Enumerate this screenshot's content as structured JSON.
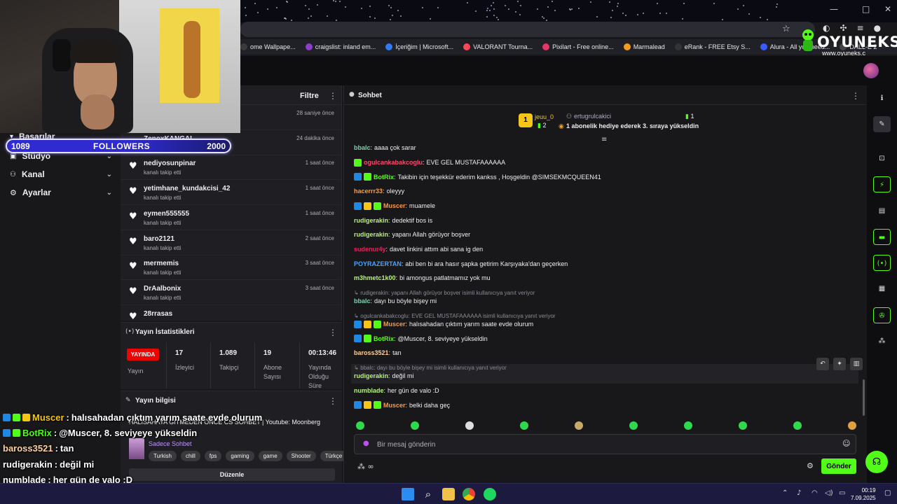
{
  "browser": {
    "bookmarks": [
      {
        "label": "ome Wallpape...",
        "color": "#3a3a3a"
      },
      {
        "label": "craigslist: inland em...",
        "color": "#8b3fc9"
      },
      {
        "label": "İçeriğim | Microsoft...",
        "color": "#2d7cf6"
      },
      {
        "label": "VALORANT Tourna...",
        "color": "#ff4655"
      },
      {
        "label": "Pixilart - Free online...",
        "color": "#e63465"
      },
      {
        "label": "Marmalead",
        "color": "#f29c1f"
      },
      {
        "label": "eRank - FREE Etsy S...",
        "color": "#333333"
      },
      {
        "label": "Alura - All you need...",
        "color": "#3b5bfd"
      },
      {
        "label": "DALL-E 2",
        "color": "#444444"
      }
    ]
  },
  "logo": {
    "name": "OYUNEKS",
    "url": "www.oyuneks.c"
  },
  "webcam": {
    "followers_current": "1089",
    "followers_label": "FOLLOWERS",
    "followers_goal": "2000",
    "progress": 0.5445
  },
  "leftnav": {
    "partial_item": "Başarılar",
    "items": [
      {
        "label": "Stüdyo",
        "icon": "video-icon"
      },
      {
        "label": "Kanal",
        "icon": "users-icon"
      },
      {
        "label": "Ayarlar",
        "icon": "gear-icon"
      }
    ]
  },
  "activity": {
    "filter_label": "Filtre",
    "items": [
      {
        "name": "",
        "sub": "",
        "time": "28 saniye önce"
      },
      {
        "name": "ZenoxKANGAL",
        "sub": "kanalı takip etti",
        "time": "24 dakika önce"
      },
      {
        "name": "nediyosunpinar",
        "sub": "kanalı takip etti",
        "time": "1 saat önce"
      },
      {
        "name": "yetimhane_kundakcisi_42",
        "sub": "kanalı takip etti",
        "time": "1 saat önce"
      },
      {
        "name": "eymen555555",
        "sub": "kanalı takip etti",
        "time": "1 saat önce"
      },
      {
        "name": "baro2121",
        "sub": "kanalı takip etti",
        "time": "2 saat önce"
      },
      {
        "name": "mermemis",
        "sub": "kanalı takip etti",
        "time": "3 saat önce"
      },
      {
        "name": "DrAalbonix",
        "sub": "kanalı takip etti",
        "time": "3 saat önce"
      },
      {
        "name": "28rrasas",
        "sub": "",
        "time": ""
      }
    ]
  },
  "stats": {
    "title": "Yayın İstatistikleri",
    "live_badge": "YAYINDA",
    "live_label": "Yayın",
    "columns": [
      {
        "value": "17",
        "label": "İzleyici"
      },
      {
        "value": "1.089",
        "label": "Takipçi"
      },
      {
        "value": "19",
        "label": "Abone Sayısı"
      },
      {
        "value": "00:13:46",
        "label": "Yayında Olduğu Süre"
      }
    ]
  },
  "stream_info": {
    "title": "Yayın bilgisi",
    "description": "HALISAHAYA GİTMEDEN ÖNCE CS SOHBET | Youtube: Moonberg",
    "category": "Sadece Sohbet",
    "tags": [
      "Turkish",
      "chill",
      "fps",
      "gaming",
      "game",
      "Shooter",
      "Türkçe"
    ],
    "edit_label": "Düzenle"
  },
  "chat": {
    "title": "Sohbet",
    "leaderboard": {
      "rank": "1",
      "first_name": "jeuu_0",
      "first_count": "2",
      "second_name": "ertugrulcakici",
      "second_count": "1",
      "message": "1 abonelik hediye ederek 3. sıraya yükseldin"
    },
    "messages": [
      {
        "user": "bbalc",
        "color": "#7fd1ae",
        "text": "aaaa çok sarar",
        "badges": []
      },
      {
        "user": "ogulcankabakcoglu",
        "color": "#ff4a6e",
        "text": "EVE GEL MUSTAFAAAAAA",
        "badges": [
          "#53fc18"
        ]
      },
      {
        "user": "BotRix",
        "color": "#53fc18",
        "text": "Takibin için teşekkür ederim kankss , Hoşgeldin @SIMSEKMCQUEEN41",
        "badges": [
          "#1e88e5",
          "#53fc18"
        ]
      },
      {
        "user": "hacerrr33",
        "color": "#ff9a3c",
        "text": "oleyyy",
        "badges": []
      },
      {
        "user": "Muscer",
        "color": "#ff9a3c",
        "text": "muamele",
        "badges": [
          "#1e88e5",
          "#f5c518",
          "#53fc18"
        ]
      },
      {
        "user": "rudigerakin",
        "color": "#b9f27a",
        "text": "dedektif bos is",
        "badges": []
      },
      {
        "user": "rudigerakin",
        "color": "#b9f27a",
        "text": "yapanı Allah görüyor boşver",
        "badges": []
      },
      {
        "user": "sudenur4y",
        "color": "#e0245e",
        "text": "davet linkini attım abi sana ig den",
        "badges": []
      },
      {
        "user": "POYRAZERTAN",
        "color": "#4aa3ff",
        "text": "abi ben bi ara hasır şapka getirim Karşıyaka'dan geçerken",
        "badges": []
      },
      {
        "user": "m3hmetc1k00",
        "color": "#b9f27a",
        "text": "bi amongus patlatmamız yok mu",
        "badges": []
      },
      {
        "reply": "rudigerakin: yapanı Allah görüyor boşver isimli kullanıcıya yanıt veriyor",
        "user": "bbalc",
        "color": "#7fd1ae",
        "text": "dayı bu böyle bişey mi",
        "badges": []
      },
      {
        "reply": "ogulcankabakcoglu: EVE GEL MUSTAFAAAAAA isimli kullanıcıya yanıt veriyor",
        "user": "Muscer",
        "color": "#ff9a3c",
        "text": "halısahadan çıktım yarım saate evde olurum",
        "badges": [
          "#1e88e5",
          "#f5c518",
          "#53fc18"
        ]
      },
      {
        "user": "BotRix",
        "color": "#53fc18",
        "text": "@Muscer, 8. seviyeye yükseldin",
        "badges": [
          "#1e88e5",
          "#53fc18"
        ]
      },
      {
        "user": "baross3521",
        "color": "#ffd39a",
        "text": "tan",
        "badges": []
      },
      {
        "reply": "bbalc: dayı bu böyle bişey mi isimli kullanıcıya yanıt veriyor",
        "user": "rudigerakin",
        "color": "#b9f27a",
        "text": "değil mi",
        "badges": []
      },
      {
        "user": "numblade",
        "color": "#b9f27a",
        "text": "her gün de valo :D",
        "badges": []
      },
      {
        "user": "Muscer",
        "color": "#ff9a3c",
        "text": "belki daha geç",
        "badges": [
          "#1e88e5",
          "#f5c518",
          "#53fc18"
        ]
      }
    ],
    "input_placeholder": "Bir mesaj gönderin",
    "send_label": "Gönder"
  },
  "overlay_chat": [
    {
      "user": "Muscer",
      "color": "#f5c518",
      "text": "halısahadan çıktım yarım saate evde olurum",
      "badges": [
        "#1e88e5",
        "#53fc18",
        "#f5c518"
      ]
    },
    {
      "user": "BotRix",
      "color": "#53fc18",
      "text": "@Muscer, 8. seviyeye yükseldin",
      "badges": [
        "#1e88e5",
        "#53fc18"
      ]
    },
    {
      "user": "baross3521",
      "color": "#ffd39a",
      "text": "tan",
      "badges": []
    },
    {
      "user": "rudigerakin",
      "color": "#ffffff",
      "text": "değil mi",
      "badges": []
    },
    {
      "user": "numblade",
      "color": "#ffffff",
      "text": "her gün de valo :D",
      "badges": []
    },
    {
      "user": "Muscer",
      "color": "#f5c518",
      "text": "belki daha geç",
      "badges": [
        "#1e88e5",
        "#53fc18",
        "#f5c518"
      ]
    }
  ],
  "taskbar": {
    "time": "00:19",
    "date": "7.09.2025"
  },
  "colors": {
    "accent": "#53fc18",
    "live": "#eb0400",
    "panel": "#1f1f23"
  }
}
